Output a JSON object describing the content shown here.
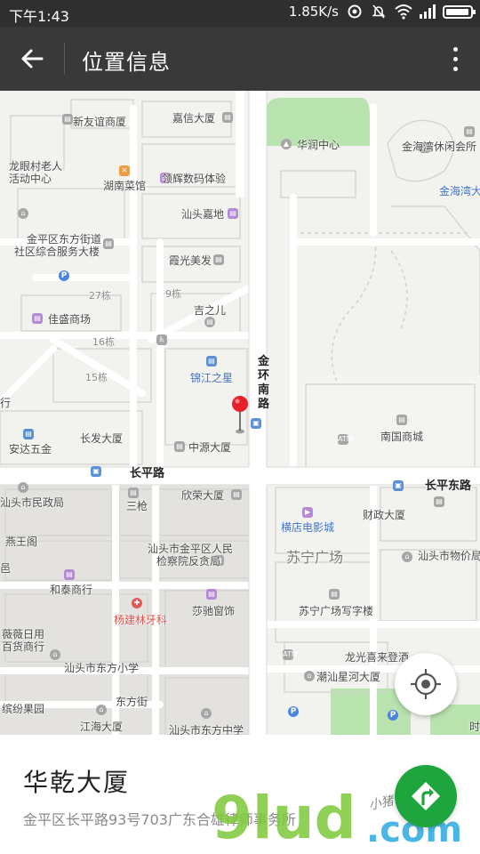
{
  "status_bar": {
    "time": "下午1:43",
    "network_speed": "1.85K/s",
    "battery_level": 0.95
  },
  "app_bar": {
    "title": "位置信息"
  },
  "map": {
    "labels": {
      "xinyoudao": "新友谊商厦",
      "jiaxin": "嘉信大厦",
      "huarun": "华润中心",
      "jinhaiwan_club": "金海湾休闲会所",
      "jinhaiwan": "金海湾大",
      "longyan_1": "龙眼村老人",
      "longyan_2": "活动中心",
      "hunan_caiguan": "湖南菜馆",
      "linghui": "领辉数码体验",
      "shantou_jiadi": "汕头嘉地",
      "jinping_office_1": "金平区东方街道",
      "jinping_office_2": "社区综合服务大楼",
      "xiaguang": "霞光美发",
      "b27": "27栋",
      "b9": "9栋",
      "jiasheng": "佳盛商场",
      "jizhier": "吉之儿",
      "b16": "16栋",
      "b15": "15栋",
      "jinjiang": "锦江之星",
      "jinhuan_road_1": "金",
      "jinhuan_road_2": "环",
      "jinhuan_road_3": "南",
      "jinhuan_road_4": "路",
      "nanguo": "南国商城",
      "hang": "行",
      "anda": "安达五金",
      "changfa": "长发大厦",
      "zhongyuan": "中源大厦",
      "changping_road": "长平路",
      "changping_east": "长平东路",
      "shantou_minzheng": "汕头市民政局",
      "sanqiang": "三枪",
      "xinrong": "欣荣大厦",
      "hengdian": "横店电影城",
      "caizheng": "财政大厦",
      "yanwangge": "燕王阁",
      "jianchayuan_1": "汕头市金平区人民",
      "jianchayuan_2": "检察院反贪局",
      "suning": "苏宁广场",
      "wujiaju": "物价局",
      "hetai": "和泰商行",
      "yangjianlin": "杨建林牙科",
      "shachi": "莎驰窗饰",
      "suning_office": "苏宁广场写字楼",
      "weiweiri_1": "薇薇日用",
      "weiweiri_2": "百货商行",
      "dongfang_primary": "汕头市东方小学",
      "longguang": "龙光喜来登酒",
      "chaoshan": "潮汕星河大厦",
      "binfen": "缤纷果园",
      "dongfang_street": "东方街",
      "jianghai": "江海大厦",
      "dongfang_middle": "汕头市东方中学",
      "wujiaju_full": "汕头市物价局",
      "e": "邑",
      "rili": "时"
    }
  },
  "place": {
    "name": "华乾大厦",
    "address": "金平区长平路93号703广东合雄律师事务所"
  },
  "watermark": {
    "main": "9lud",
    "sub": ".com",
    "script": "小猪书院网"
  },
  "colors": {
    "status_bar_bg": "#2f2f2f",
    "app_bar_bg": "#393939",
    "nav_button": "#1fa53e",
    "pin": "#e8202a",
    "park_green": "#b9e3ae",
    "watermark_green": "#7dc83a"
  },
  "icons": {
    "back": "arrow-left-icon",
    "more": "more-vertical-icon",
    "locate": "crosshair-icon",
    "navigate": "navigation-icon",
    "pin": "map-pin-icon"
  }
}
